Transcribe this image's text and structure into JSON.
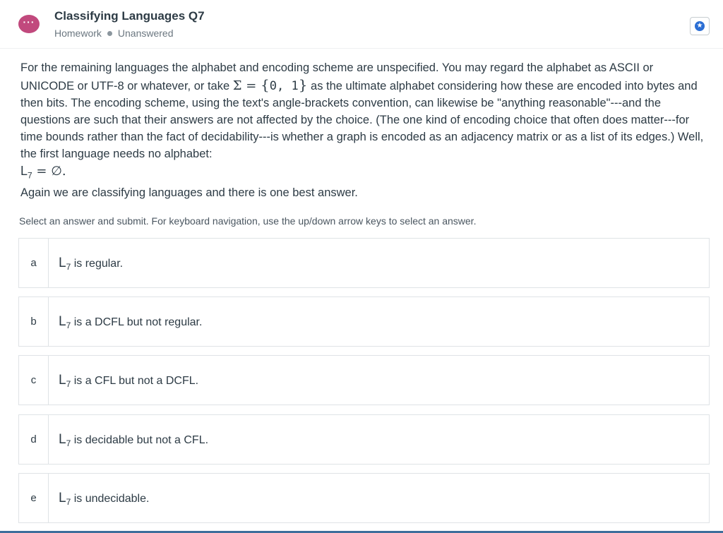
{
  "header": {
    "avatar_glyph": "···",
    "title": "Classifying Languages Q7",
    "type": "Homework",
    "status": "Unanswered",
    "star_icon": "star-icon",
    "accent_color": "#c1497d",
    "star_color": "#2b6ed4"
  },
  "question": {
    "p1_before_sigma": "For the remaining languages the alphabet and encoding scheme are unspecified. You may regard the alphabet as ASCII or UNICODE or UTF-8 or whatever, or take ",
    "sigma": "Σ",
    "equals": " = ",
    "set_open": "{",
    "set_content": "0, 1",
    "set_close": "}",
    "p1_after_set": " as the ultimate alphabet considering how these are encoded into bytes and then bits. The encoding scheme, using the text's angle-brackets convention, can likewise be \"anything reasonable\"---and the questions are such that their answers are not affected by the choice. (The one kind of encoding choice that often does matter---for time bounds rather than the fact of decidability---is whether a graph is encoded as an adjacency matrix or as a list of its edges.) Well, the first language needs no alphabet:",
    "lang_L": "L",
    "lang_sub": "7",
    "lang_rest": " = ∅.",
    "closing": "Again we are classifying languages and there is one best answer."
  },
  "instructions": "Select an answer and submit. For keyboard navigation, use the up/down arrow keys to select an answer.",
  "options": [
    {
      "letter": "a",
      "L": "L",
      "sub": "7",
      "text": " is regular."
    },
    {
      "letter": "b",
      "L": "L",
      "sub": "7",
      "text": " is a DCFL but not regular."
    },
    {
      "letter": "c",
      "L": "L",
      "sub": "7",
      "text": " is a CFL but not a DCFL."
    },
    {
      "letter": "d",
      "L": "L",
      "sub": "7",
      "text": " is decidable but not a CFL."
    },
    {
      "letter": "e",
      "L": "L",
      "sub": "7",
      "text": " is undecidable."
    }
  ]
}
